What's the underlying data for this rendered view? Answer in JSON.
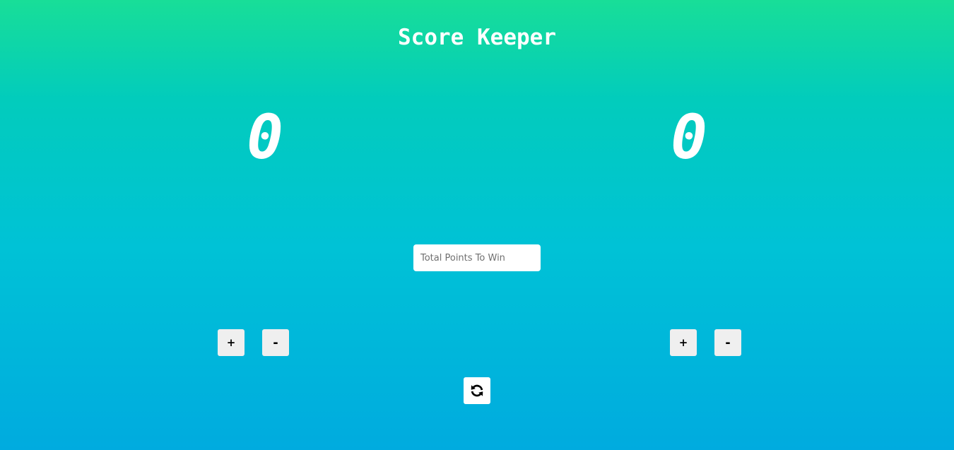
{
  "header": {
    "title": "Score Keeper"
  },
  "players": [
    {
      "score": "0",
      "increment_label": "+",
      "decrement_label": "-"
    },
    {
      "score": "0",
      "increment_label": "+",
      "decrement_label": "-"
    }
  ],
  "target": {
    "value": "",
    "placeholder": "Total Points To Win"
  },
  "reset": {
    "icon": "refresh-icon"
  },
  "colors": {
    "gradient_top": "#18de98",
    "gradient_bottom": "#00abdf",
    "text": "#ffffff",
    "button_bg": "#efefef"
  }
}
